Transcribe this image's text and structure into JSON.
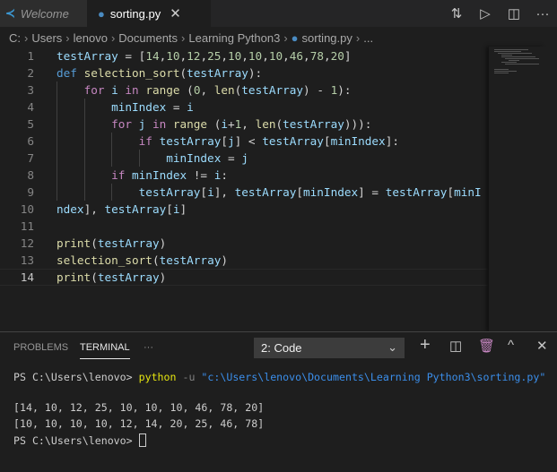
{
  "tabs": [
    {
      "label": "Welcome",
      "icon": "vscode-logo-icon"
    },
    {
      "label": "sorting.py",
      "icon": "python-icon",
      "close": "✕"
    }
  ],
  "actions": [
    "compare-changes-icon",
    "run-icon",
    "split-editor-icon",
    "more-icon"
  ],
  "breadcrumbs": [
    "C:",
    "Users",
    "lenovo",
    "Documents",
    "Learning Python3",
    "sorting.py",
    "..."
  ],
  "colors": {
    "keyword": "#569cd6",
    "control": "#c586c0",
    "function": "#dcdcaa",
    "variable": "#9cdcfe",
    "number": "#b5cea8",
    "text": "#d4d4d4"
  },
  "lines": [
    [
      [
        "v",
        "testArray"
      ],
      [
        "t",
        " = ["
      ],
      [
        "n",
        "14"
      ],
      [
        "t",
        ","
      ],
      [
        "n",
        "10"
      ],
      [
        "t",
        ","
      ],
      [
        "n",
        "12"
      ],
      [
        "t",
        ","
      ],
      [
        "n",
        "25"
      ],
      [
        "t",
        ","
      ],
      [
        "n",
        "10"
      ],
      [
        "t",
        ","
      ],
      [
        "n",
        "10"
      ],
      [
        "t",
        ","
      ],
      [
        "n",
        "10"
      ],
      [
        "t",
        ","
      ],
      [
        "n",
        "46"
      ],
      [
        "t",
        ","
      ],
      [
        "n",
        "78"
      ],
      [
        "t",
        ","
      ],
      [
        "n",
        "20"
      ],
      [
        "t",
        "]"
      ]
    ],
    [
      [
        "k",
        "def"
      ],
      [
        "t",
        " "
      ],
      [
        "f",
        "selection_sort"
      ],
      [
        "t",
        "("
      ],
      [
        "v",
        "testArray"
      ],
      [
        "t",
        "):"
      ]
    ],
    [
      [
        "t",
        "    "
      ],
      [
        "c",
        "for"
      ],
      [
        "t",
        " "
      ],
      [
        "v",
        "i"
      ],
      [
        "t",
        " "
      ],
      [
        "c",
        "in"
      ],
      [
        "t",
        " "
      ],
      [
        "f",
        "range"
      ],
      [
        "t",
        " ("
      ],
      [
        "n",
        "0"
      ],
      [
        "t",
        ", "
      ],
      [
        "f",
        "len"
      ],
      [
        "t",
        "("
      ],
      [
        "v",
        "testArray"
      ],
      [
        "t",
        ") - "
      ],
      [
        "n",
        "1"
      ],
      [
        "t",
        "):"
      ]
    ],
    [
      [
        "t",
        "        "
      ],
      [
        "v",
        "minIndex"
      ],
      [
        "t",
        " = "
      ],
      [
        "v",
        "i"
      ]
    ],
    [
      [
        "t",
        "        "
      ],
      [
        "c",
        "for"
      ],
      [
        "t",
        " "
      ],
      [
        "v",
        "j"
      ],
      [
        "t",
        " "
      ],
      [
        "c",
        "in"
      ],
      [
        "t",
        " "
      ],
      [
        "f",
        "range"
      ],
      [
        "t",
        " ("
      ],
      [
        "v",
        "i"
      ],
      [
        "t",
        "+"
      ],
      [
        "n",
        "1"
      ],
      [
        "t",
        ", "
      ],
      [
        "f",
        "len"
      ],
      [
        "t",
        "("
      ],
      [
        "v",
        "testArray"
      ],
      [
        "t",
        "))):"
      ]
    ],
    [
      [
        "t",
        "            "
      ],
      [
        "c",
        "if"
      ],
      [
        "t",
        " "
      ],
      [
        "v",
        "testArray"
      ],
      [
        "t",
        "["
      ],
      [
        "v",
        "j"
      ],
      [
        "t",
        "] < "
      ],
      [
        "v",
        "testArray"
      ],
      [
        "t",
        "["
      ],
      [
        "v",
        "minIndex"
      ],
      [
        "t",
        "]:"
      ]
    ],
    [
      [
        "t",
        "                "
      ],
      [
        "v",
        "minIndex"
      ],
      [
        "t",
        " = "
      ],
      [
        "v",
        "j"
      ]
    ],
    [
      [
        "t",
        "        "
      ],
      [
        "c",
        "if"
      ],
      [
        "t",
        " "
      ],
      [
        "v",
        "minIndex"
      ],
      [
        "t",
        " != "
      ],
      [
        "v",
        "i"
      ],
      [
        "t",
        ":"
      ]
    ],
    [
      [
        "t",
        "            "
      ],
      [
        "v",
        "testArray"
      ],
      [
        "t",
        "["
      ],
      [
        "v",
        "i"
      ],
      [
        "t",
        "], "
      ],
      [
        "v",
        "testArray"
      ],
      [
        "t",
        "["
      ],
      [
        "v",
        "minIndex"
      ],
      [
        "t",
        "] = "
      ],
      [
        "v",
        "testArray"
      ],
      [
        "t",
        "["
      ],
      [
        "v",
        "minIndex"
      ],
      [
        "t",
        "], "
      ],
      [
        "v",
        "testArray"
      ],
      [
        "t",
        "["
      ],
      [
        "v",
        "i"
      ],
      [
        "t",
        "]"
      ]
    ],
    [],
    [],
    [
      [
        "f",
        "print"
      ],
      [
        "t",
        "("
      ],
      [
        "v",
        "testArray"
      ],
      [
        "t",
        ")"
      ]
    ],
    [
      [
        "f",
        "selection_sort"
      ],
      [
        "t",
        "("
      ],
      [
        "v",
        "testArray"
      ],
      [
        "t",
        ")"
      ]
    ],
    [
      [
        "f",
        "print"
      ],
      [
        "t",
        "("
      ],
      [
        "v",
        "testArray"
      ],
      [
        "t",
        ")"
      ]
    ]
  ],
  "current_line": 14,
  "panel": {
    "tabs": [
      "PROBLEMS",
      "TERMINAL",
      "···"
    ],
    "active_tab": "TERMINAL",
    "terminal_select": "2: Code",
    "actions": [
      "add-icon",
      "split-icon",
      "trash-icon",
      "maximize-icon",
      "close-icon"
    ]
  },
  "terminal": {
    "prompt": "PS C:\\Users\\lenovo> ",
    "cmd": "python",
    "flag": " -u ",
    "path": "\"c:\\Users\\lenovo\\Documents\\Learning Python3\\sorting.py\"",
    "out1": "[14, 10, 12, 25, 10, 10, 10, 46, 78, 20]",
    "out2": "[10, 10, 10, 10, 12, 14, 20, 25, 46, 78]",
    "prompt2": "PS C:\\Users\\lenovo> "
  }
}
